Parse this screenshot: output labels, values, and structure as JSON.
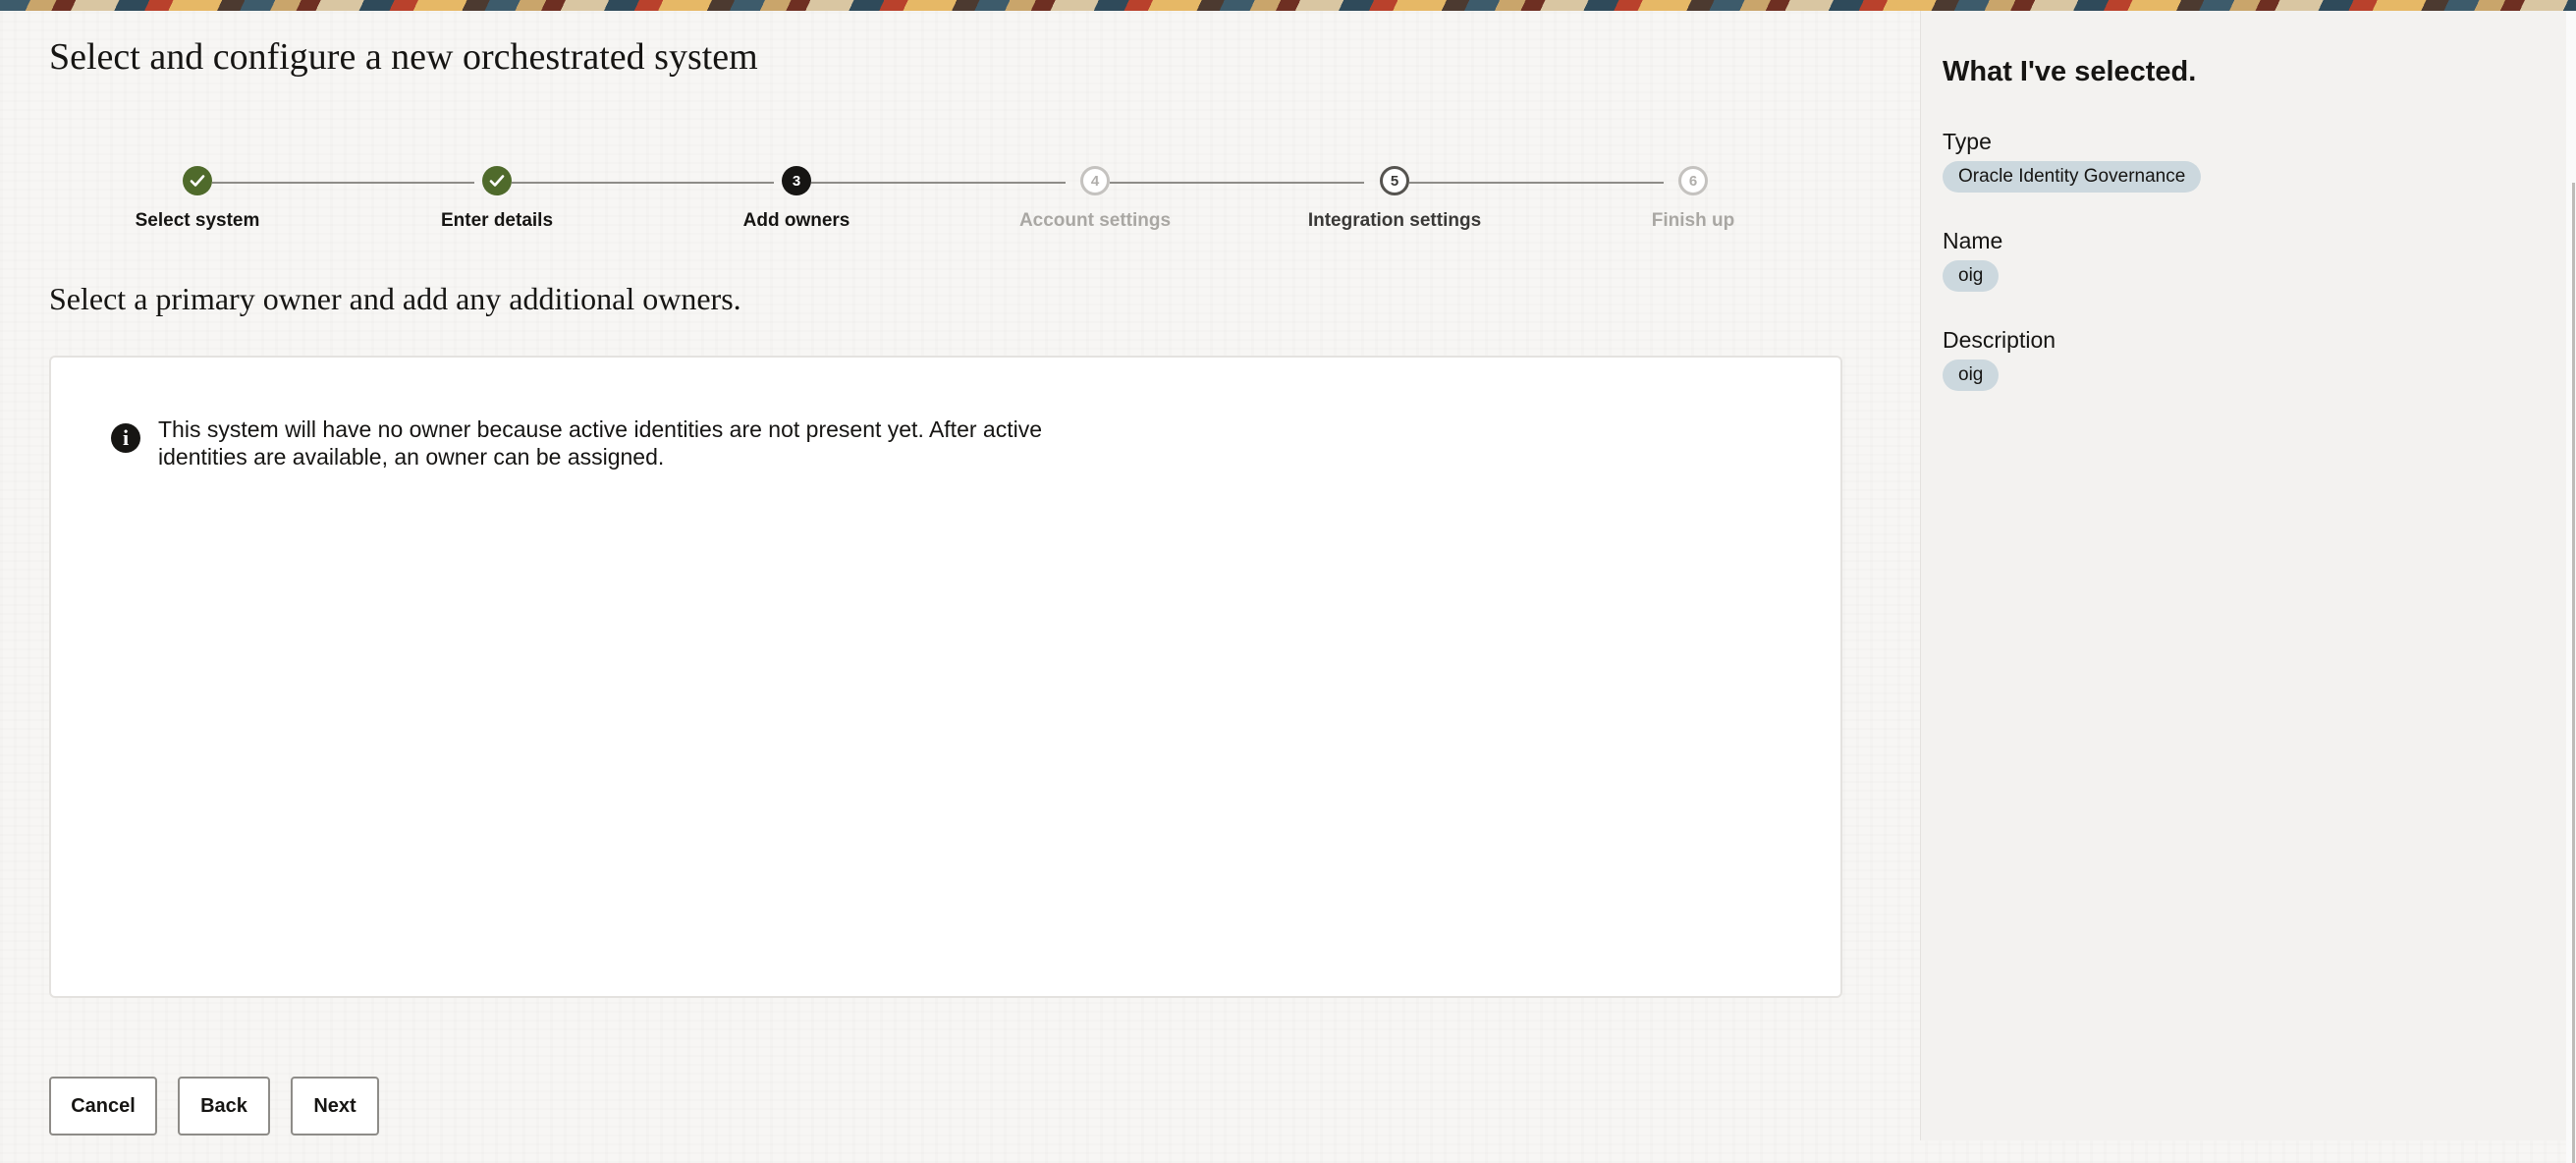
{
  "page": {
    "title": "Select and configure a new orchestrated system",
    "section_heading": "Select a primary owner and add any additional owners."
  },
  "train": {
    "steps": [
      {
        "marker": "",
        "label": "Select system",
        "state": "complete"
      },
      {
        "marker": "",
        "label": "Enter details",
        "state": "complete"
      },
      {
        "marker": "3",
        "label": "Add owners",
        "state": "current"
      },
      {
        "marker": "4",
        "label": "Account settings",
        "state": "disabled"
      },
      {
        "marker": "5",
        "label": "Integration settings",
        "state": "visited"
      },
      {
        "marker": "6",
        "label": "Finish up",
        "state": "disabled"
      }
    ]
  },
  "content": {
    "info_message": "This system will have no owner because active identities are not present yet. After active identities are available, an owner can be assigned."
  },
  "buttons": {
    "cancel": "Cancel",
    "back": "Back",
    "next": "Next"
  },
  "summary": {
    "title": "What I've selected.",
    "type_label": "Type",
    "type_value": "Oracle Identity Governance",
    "name_label": "Name",
    "name_value": "oig",
    "description_label": "Description",
    "description_value": "oig"
  },
  "colors": {
    "complete": "#4f6a2b",
    "current": "#161513",
    "chip": "#ccd8de",
    "panel": "#f3f2f0"
  }
}
